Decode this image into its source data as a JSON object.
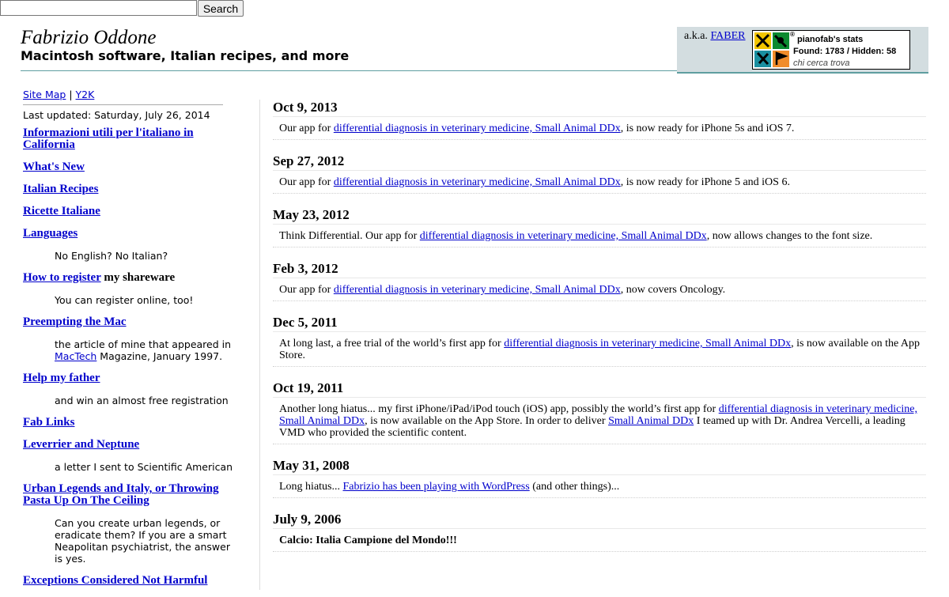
{
  "search": {
    "value": "",
    "button": "Search"
  },
  "header": {
    "name": "Fabrizio Oddone",
    "tagline": "Macintosh software, Italian recipes, and more",
    "aka_prefix": "a.k.a.",
    "aka_link": "FABER",
    "badge": {
      "registered_mark": "®",
      "user": "pianofab's stats",
      "stats": "Found: 1783 / Hidden: 58",
      "motto": "chi cerca trova"
    }
  },
  "sidebar": {
    "site_map": "Site Map",
    "separator": "|",
    "y2k": "Y2K",
    "last_updated": "Last updated: Saturday, July 26, 2014",
    "items": [
      {
        "link": "Informazioni utili per l'italiano in California"
      },
      {
        "link": "What's New"
      },
      {
        "link": "Italian Recipes"
      },
      {
        "link": "Ricette Italiane"
      },
      {
        "link": "Languages"
      },
      {
        "desc": "No English? No Italian?"
      },
      {
        "link": "How to register",
        "suffix": " my shareware"
      },
      {
        "desc": "You can register online, too!"
      },
      {
        "link": "Preempting the Mac"
      },
      {
        "desc_pre": "the article of mine that appeared in ",
        "desc_link": "MacTech",
        "desc_post": " Magazine, January 1997."
      },
      {
        "link": "Help my father"
      },
      {
        "desc": "and win an almost free registration"
      },
      {
        "link": "Fab Links"
      },
      {
        "link": "Leverrier and Neptune"
      },
      {
        "desc": "a letter I sent to Scientific American"
      },
      {
        "link": "Urban Legends and Italy, or Throwing Pasta Up On The Ceiling"
      },
      {
        "desc": "Can you create urban legends, or eradicate them? If you are a smart Neapolitan psychiatrist, the answer is yes."
      },
      {
        "link": "Exceptions Considered Not Harmful"
      }
    ]
  },
  "news": [
    {
      "date": "Oct 9, 2013",
      "parts": [
        {
          "t": "Our app for "
        },
        {
          "t": "differential diagnosis in veterinary medicine, Small Animal DDx",
          "link": true
        },
        {
          "t": ", is now ready for iPhone 5s and iOS 7."
        }
      ]
    },
    {
      "date": "Sep 27, 2012",
      "parts": [
        {
          "t": "Our app for "
        },
        {
          "t": "differential diagnosis in veterinary medicine, Small Animal DDx",
          "link": true
        },
        {
          "t": ", is now ready for iPhone 5 and iOS 6."
        }
      ]
    },
    {
      "date": "May 23, 2012",
      "parts": [
        {
          "t": "Think Differential. Our app for "
        },
        {
          "t": "differential diagnosis in veterinary medicine, Small Animal DDx",
          "link": true
        },
        {
          "t": ", now allows changes to the font size."
        }
      ]
    },
    {
      "date": "Feb 3, 2012",
      "parts": [
        {
          "t": "Our app for "
        },
        {
          "t": "differential diagnosis in veterinary medicine, Small Animal DDx",
          "link": true
        },
        {
          "t": ", now covers Oncology."
        }
      ]
    },
    {
      "date": "Dec 5, 2011",
      "parts": [
        {
          "t": "At long last, a free trial of the world’s first app for "
        },
        {
          "t": "differential diagnosis in veterinary medicine, Small Animal DDx",
          "link": true
        },
        {
          "t": ", is now available on the App Store."
        }
      ]
    },
    {
      "date": "Oct 19, 2011",
      "parts": [
        {
          "t": "Another long hiatus... my first iPhone/iPad/iPod touch (iOS) app, possibly the world’s first app for "
        },
        {
          "t": "differential diagnosis in veterinary medicine, Small Animal DDx",
          "link": true
        },
        {
          "t": ", is now available on the App Store. In order to deliver "
        },
        {
          "t": "Small Animal DDx",
          "link": true
        },
        {
          "t": " I teamed up with Dr. Andrea Vercelli, a leading VMD who provided the scientific content."
        }
      ]
    },
    {
      "date": "May 31, 2008",
      "parts": [
        {
          "t": "Long hiatus... "
        },
        {
          "t": "Fabrizio has been playing with WordPress",
          "link": true
        },
        {
          "t": " (and other things)..."
        }
      ]
    },
    {
      "date": "July 9, 2006",
      "bold": true,
      "parts": [
        {
          "t": "Calcio: Italia Campione del Mondo!!!"
        }
      ]
    }
  ]
}
